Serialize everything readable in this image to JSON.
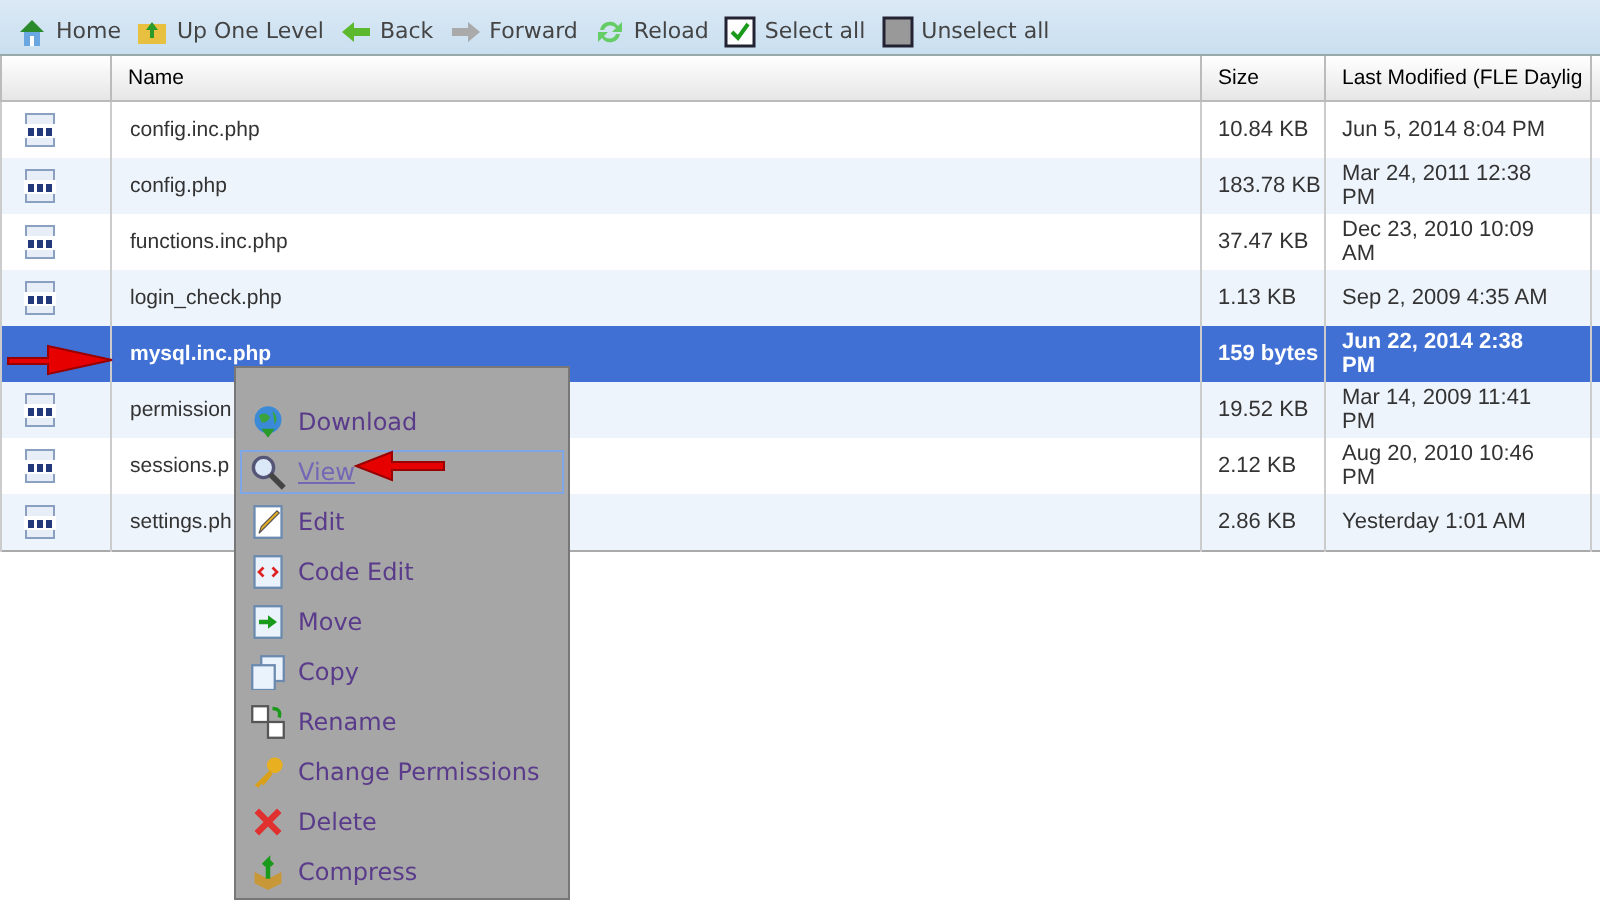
{
  "toolbar": [
    {
      "label": "Home"
    },
    {
      "label": "Up One Level"
    },
    {
      "label": "Back"
    },
    {
      "label": "Forward"
    },
    {
      "label": "Reload"
    },
    {
      "label": "Select all"
    },
    {
      "label": "Unselect all"
    }
  ],
  "table": {
    "columns": [
      "Name",
      "Size",
      "Last Modified (FLE Daylig"
    ],
    "rows": [
      {
        "name": "config.inc.php",
        "size": "10.84 KB",
        "modified": "Jun 5, 2014 8:04 PM",
        "selected": false
      },
      {
        "name": "config.php",
        "size": "183.78 KB",
        "modified": "Mar 24, 2011 12:38 PM",
        "selected": false
      },
      {
        "name": "functions.inc.php",
        "size": "37.47 KB",
        "modified": "Dec 23, 2010 10:09 AM",
        "selected": false
      },
      {
        "name": "login_check.php",
        "size": "1.13 KB",
        "modified": "Sep 2, 2009 4:35 AM",
        "selected": false
      },
      {
        "name": "mysql.inc.php",
        "size": "159 bytes",
        "modified": "Jun 22, 2014 2:38 PM",
        "selected": true
      },
      {
        "name": "permission",
        "size": "19.52 KB",
        "modified": "Mar 14, 2009 11:41 PM",
        "selected": false
      },
      {
        "name": "sessions.p",
        "size": "2.12 KB",
        "modified": "Aug 20, 2010 10:46 PM",
        "selected": false
      },
      {
        "name": "settings.ph",
        "size": "2.86 KB",
        "modified": "Yesterday 1:01 AM",
        "selected": false
      }
    ]
  },
  "context_menu": {
    "items": [
      {
        "label": "Download",
        "selected": false
      },
      {
        "label": "View",
        "selected": true
      },
      {
        "label": "Edit",
        "selected": false
      },
      {
        "label": "Code Edit",
        "selected": false
      },
      {
        "label": "Move",
        "selected": false
      },
      {
        "label": "Copy",
        "selected": false
      },
      {
        "label": "Rename",
        "selected": false
      },
      {
        "label": "Change Permissions",
        "selected": false
      },
      {
        "label": "Delete",
        "selected": false
      },
      {
        "label": "Compress",
        "selected": false
      }
    ]
  }
}
